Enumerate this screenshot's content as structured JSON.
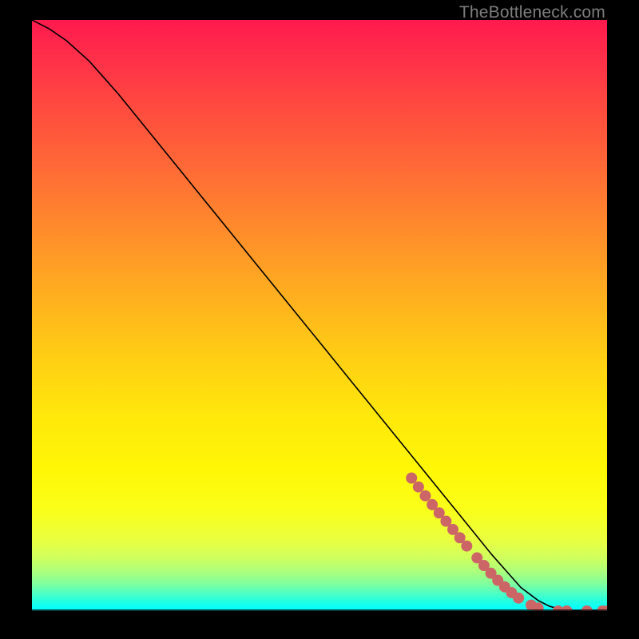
{
  "watermark": "TheBottleneck.com",
  "colors": {
    "dot": "#cc6666",
    "curve": "#000000",
    "frame": "#000000"
  },
  "chart_data": {
    "type": "line",
    "title": "",
    "xlabel": "",
    "ylabel": "",
    "xlim": [
      0,
      100
    ],
    "ylim": [
      0,
      100
    ],
    "grid": false,
    "legend": false,
    "series": [
      {
        "name": "curve",
        "x": [
          0,
          3,
          6,
          10,
          15,
          20,
          25,
          30,
          35,
          40,
          45,
          50,
          55,
          60,
          65,
          70,
          75,
          80,
          85,
          88,
          90,
          92,
          94,
          96,
          98,
          100
        ],
        "y": [
          100,
          98.5,
          96.5,
          93.0,
          87.5,
          81.5,
          75.5,
          69.5,
          63.5,
          57.5,
          51.5,
          45.5,
          39.5,
          33.5,
          27.5,
          21.5,
          15.5,
          9.5,
          4.0,
          1.8,
          0.8,
          0.3,
          0.1,
          0.0,
          0.0,
          0.0
        ]
      }
    ],
    "points": [
      {
        "x": 66.0,
        "y": 22.5
      },
      {
        "x": 67.2,
        "y": 21.0
      },
      {
        "x": 68.4,
        "y": 19.5
      },
      {
        "x": 69.6,
        "y": 18.0
      },
      {
        "x": 70.8,
        "y": 16.6
      },
      {
        "x": 72.0,
        "y": 15.2
      },
      {
        "x": 73.2,
        "y": 13.8
      },
      {
        "x": 74.4,
        "y": 12.4
      },
      {
        "x": 75.6,
        "y": 11.0
      },
      {
        "x": 77.4,
        "y": 9.0
      },
      {
        "x": 78.6,
        "y": 7.7
      },
      {
        "x": 79.8,
        "y": 6.4
      },
      {
        "x": 81.0,
        "y": 5.2
      },
      {
        "x": 82.2,
        "y": 4.1
      },
      {
        "x": 83.4,
        "y": 3.1
      },
      {
        "x": 84.6,
        "y": 2.2
      },
      {
        "x": 86.8,
        "y": 1.0
      },
      {
        "x": 88.0,
        "y": 0.5
      },
      {
        "x": 91.5,
        "y": 0.0
      },
      {
        "x": 93.0,
        "y": 0.0
      },
      {
        "x": 96.5,
        "y": 0.0
      },
      {
        "x": 99.2,
        "y": 0.0
      },
      {
        "x": 100.0,
        "y": 0.0
      }
    ],
    "gradient_note": "vertical red-yellow-green-cyan heatmap background"
  }
}
